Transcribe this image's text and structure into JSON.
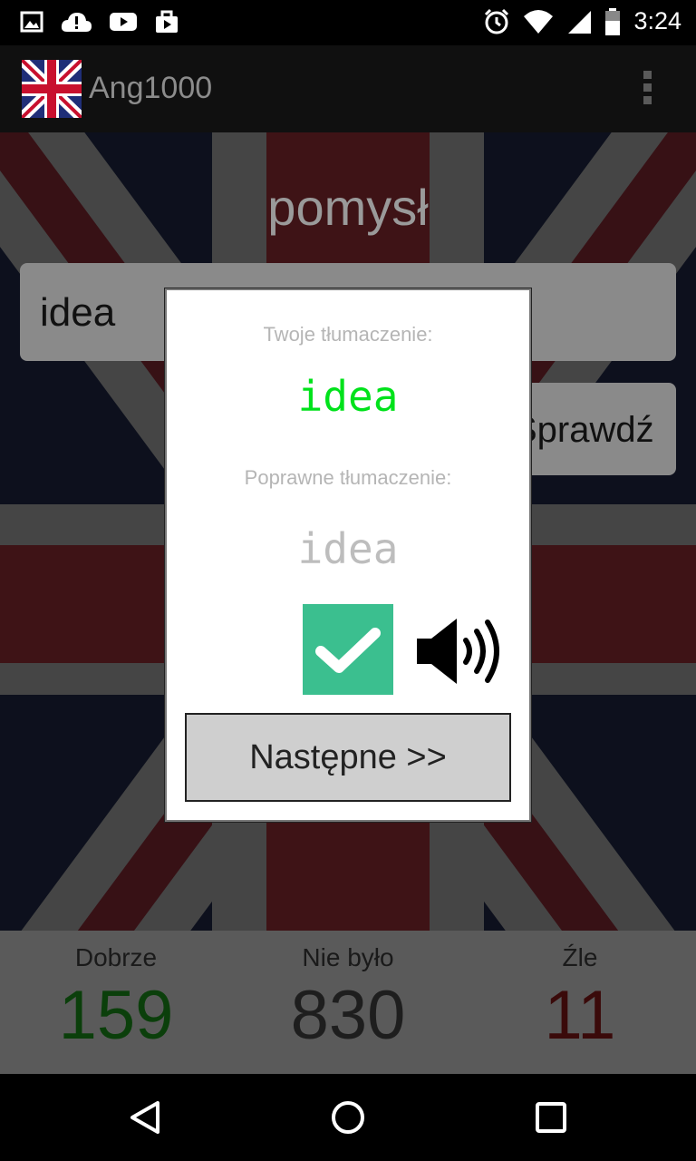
{
  "status_bar": {
    "time": "3:24",
    "icons": [
      "image-icon",
      "cloud-alert-icon",
      "youtube-icon",
      "bag-icon",
      "alarm-icon",
      "wifi-icon",
      "signal-icon",
      "battery-icon"
    ]
  },
  "app_bar": {
    "title": "Ang1000",
    "logo": "uk-flag-icon",
    "menu": "overflow-menu-icon"
  },
  "main": {
    "word": "pomysł",
    "input_value": "idea",
    "check_button_label": "Sprawdź"
  },
  "stats": {
    "good_label": "Dobrze",
    "good_value": "159",
    "unseen_label": "Nie było",
    "unseen_value": "830",
    "bad_label": "Źle",
    "bad_value": "11"
  },
  "dialog": {
    "your_translation_label": "Twoje tłumaczenie:",
    "your_translation": "idea",
    "correct_translation_label": "Poprawne tłumaczenie:",
    "correct_translation": "idea",
    "result_icon": "checkmark-icon",
    "sound_icon": "speaker-icon",
    "next_button_label": "Następne >>"
  },
  "colors": {
    "correct_green": "#00e21b",
    "check_box": "#3bbf8f",
    "good_stat": "#0b3f0b",
    "bad_stat": "#3a0a0a"
  },
  "nav_bar": {
    "back": "back-icon",
    "home": "home-icon",
    "recents": "recents-icon"
  }
}
